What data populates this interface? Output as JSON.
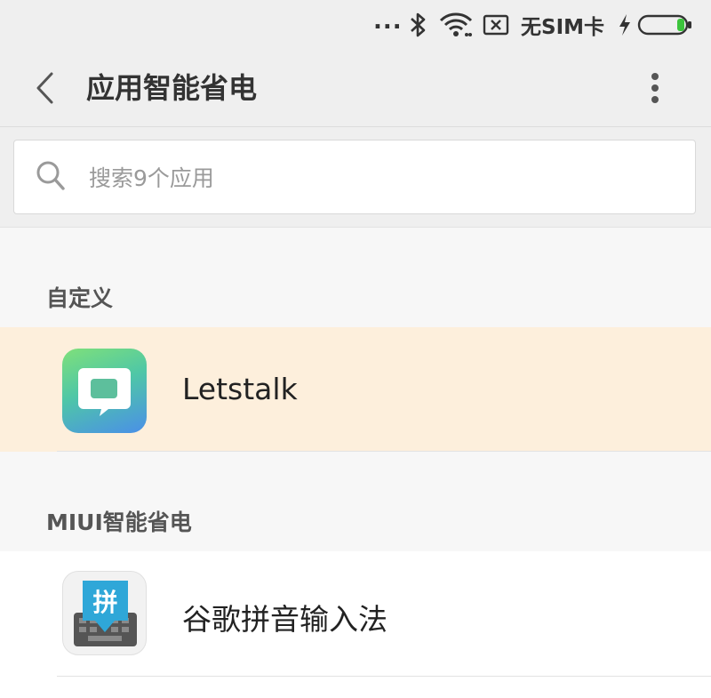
{
  "status_bar": {
    "dots": "...",
    "bluetooth_icon": "bluetooth-icon",
    "wifi_icon": "wifi-icon",
    "sim_icon": "no-sim-icon",
    "carrier": "无SIM卡",
    "charging_icon": "charging-bolt-icon",
    "battery_icon": "battery-icon"
  },
  "header": {
    "title": "应用智能省电",
    "back_icon": "chevron-left-icon",
    "more_icon": "more-vertical-icon"
  },
  "search": {
    "placeholder": "搜索9个应用",
    "value": ""
  },
  "sections": [
    {
      "header": "自定义",
      "items": [
        {
          "label": "Letstalk",
          "icon": "letstalk-app-icon"
        }
      ]
    },
    {
      "header": "MIUI智能省电",
      "items": [
        {
          "label": "谷歌拼音输入法",
          "icon": "google-pinyin-app-icon",
          "icon_text": "拼"
        }
      ]
    }
  ],
  "colors": {
    "highlight_row": "#fdefdc",
    "battery_green": "#3cc43c",
    "background": "#f7f7f7"
  }
}
